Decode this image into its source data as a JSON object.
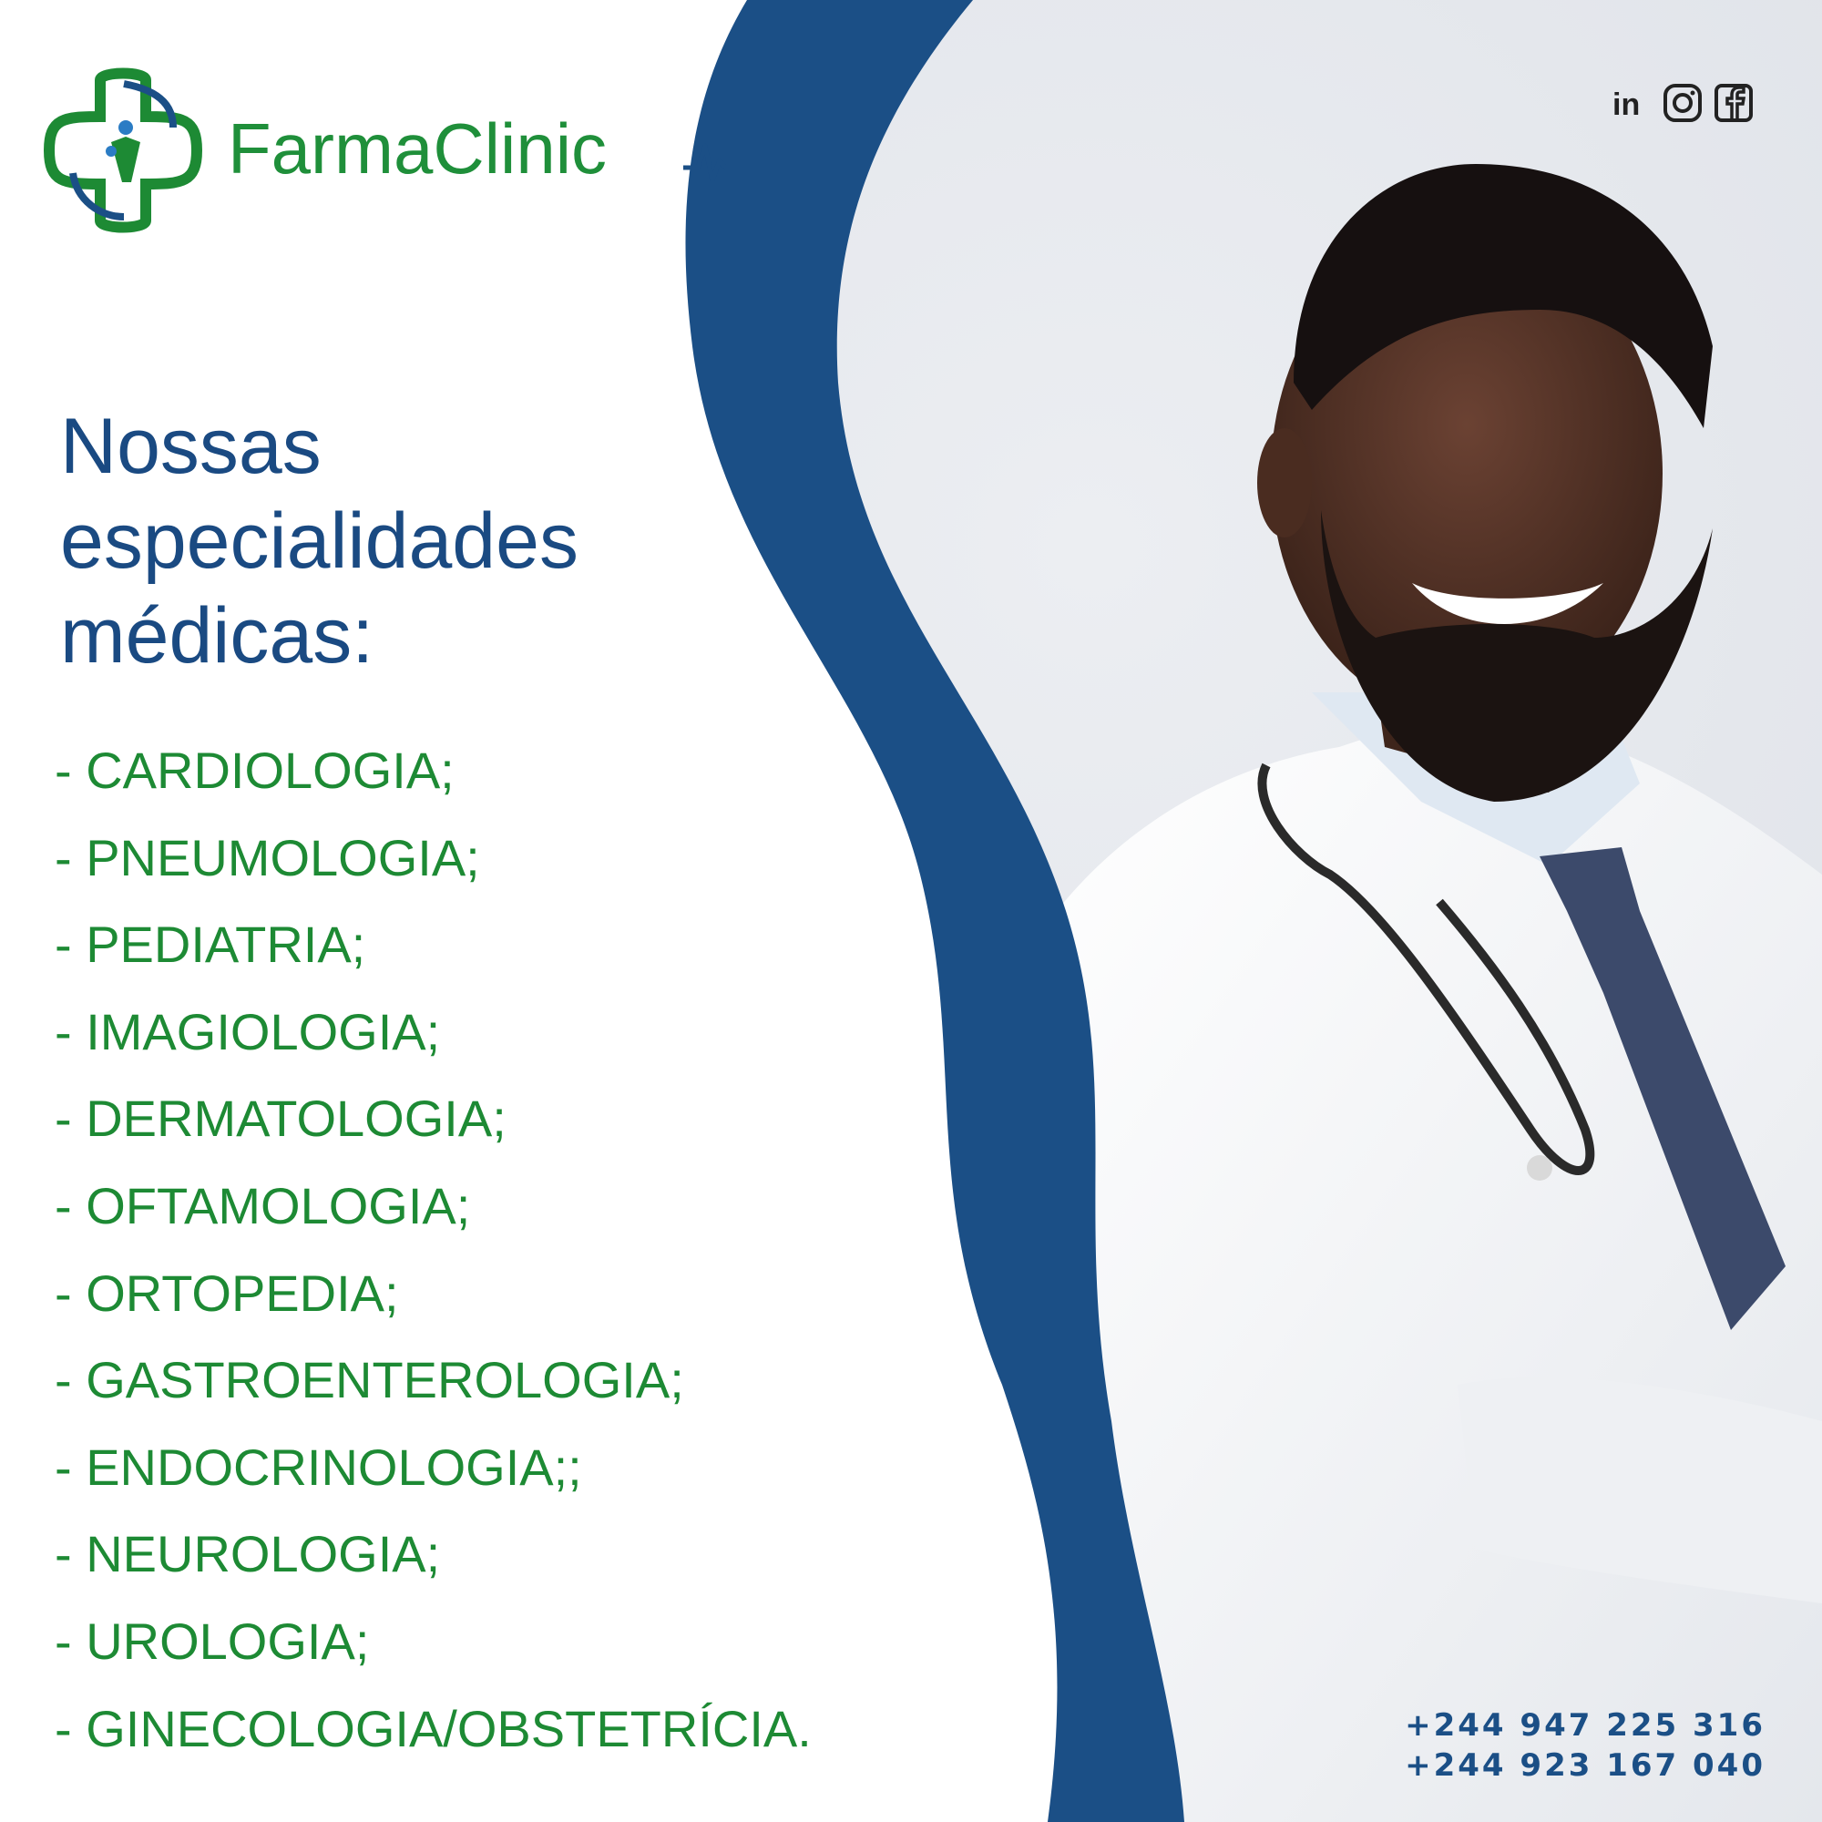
{
  "brand": {
    "name": "FarmaClinic",
    "colors": {
      "blue": "#1b4f86",
      "green": "#1d8a34",
      "light_bg": "#e3e6ec"
    }
  },
  "social_icons": [
    "linkedin-icon",
    "instagram-icon",
    "facebook-icon"
  ],
  "headline": [
    "Nossas",
    "especialidades",
    "médicas:"
  ],
  "specialties": [
    "- CARDIOLOGIA;",
    "- PNEUMOLOGIA;",
    "- PEDIATRIA;",
    "- IMAGIOLOGIA;",
    "- DERMATOLOGIA;",
    "- OFTAMOLOGIA;",
    "- ORTOPEDIA;",
    "- GASTROENTEROLOGIA;",
    "- ENDOCRINOLOGIA;;",
    "- NEUROLOGIA;",
    "- UROLOGIA;",
    "- GINECOLOGIA/OBSTETRÍCIA."
  ],
  "phones": [
    "+244 947 225 316",
    "+244 923 167 040"
  ]
}
